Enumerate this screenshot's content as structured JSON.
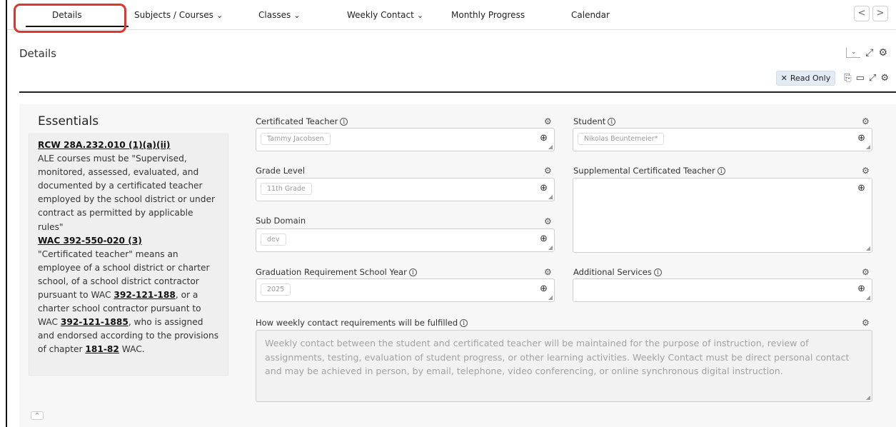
{
  "tabs": [
    {
      "label": "Details",
      "dropdown": false,
      "active": true
    },
    {
      "label": "Subjects / Courses",
      "dropdown": true
    },
    {
      "label": "Classes",
      "dropdown": true
    },
    {
      "label": "Weekly Contact",
      "dropdown": true
    },
    {
      "label": "Monthly Progress",
      "dropdown": false
    },
    {
      "label": "Calendar",
      "dropdown": false
    }
  ],
  "nav": {
    "prev": "<",
    "next": ">"
  },
  "header": {
    "title": "Details",
    "read_only_label": "Read Only"
  },
  "essentials": {
    "title": "Essentials",
    "ref1": "RCW 28A.232.010 (1)(a)(ii)",
    "text1": "ALE courses must be \"Supervised, monitored, assessed, evaluated, and documented by a certificated teacher employed by the school district or under contract as permitted by applicable rules\"",
    "ref2": "WAC 392-550-020 (3)",
    "text2a": "\"Certificated teacher\" means an employee of a school district or charter school, of a school district contractor pursuant to WAC ",
    "link1": "392-121-188",
    "text2b": ", or a charter school contractor pursuant to WAC ",
    "link2": "392-121-1885",
    "text2c": ", who is assigned and endorsed according to the provisions of chapter ",
    "link3": "181-82",
    "text2d": " WAC."
  },
  "fields": {
    "certificated_teacher": {
      "label": "Certificated Teacher",
      "value": "Tammy Jacobsen"
    },
    "student": {
      "label": "Student",
      "value": "Nikolas Beuntemeier*"
    },
    "grade_level": {
      "label": "Grade Level",
      "value": "11th Grade"
    },
    "supplemental_teacher": {
      "label": "Supplemental Certificated Teacher",
      "value": ""
    },
    "sub_domain": {
      "label": "Sub Domain",
      "value": "dev"
    },
    "grad_year": {
      "label": "Graduation Requirement School Year",
      "value": "2025"
    },
    "additional_services": {
      "label": "Additional Services",
      "value": ""
    },
    "weekly_contact": {
      "label": "How weekly contact requirements will be fulfilled",
      "value": "Weekly contact between the student and certificated teacher will be maintained for the purpose of instruction, review of assignments, testing, evaluation of student progress, or other learning activities. Weekly Contact must be direct personal contact and may be achieved in person, by email, telephone, video conferencing, or online synchronous digital instruction."
    }
  },
  "icons": {
    "info": "i",
    "gear": "⚙",
    "zoom": "⊕",
    "chevron_down": "⌄",
    "chevron_up": "^",
    "expand": "⤢",
    "read_only": "✕",
    "desktop": "▭",
    "copy": "⎘",
    "resize": "◢"
  },
  "colors": {
    "highlight": "#e2342a",
    "badge_bg": "#e3ecf5"
  }
}
